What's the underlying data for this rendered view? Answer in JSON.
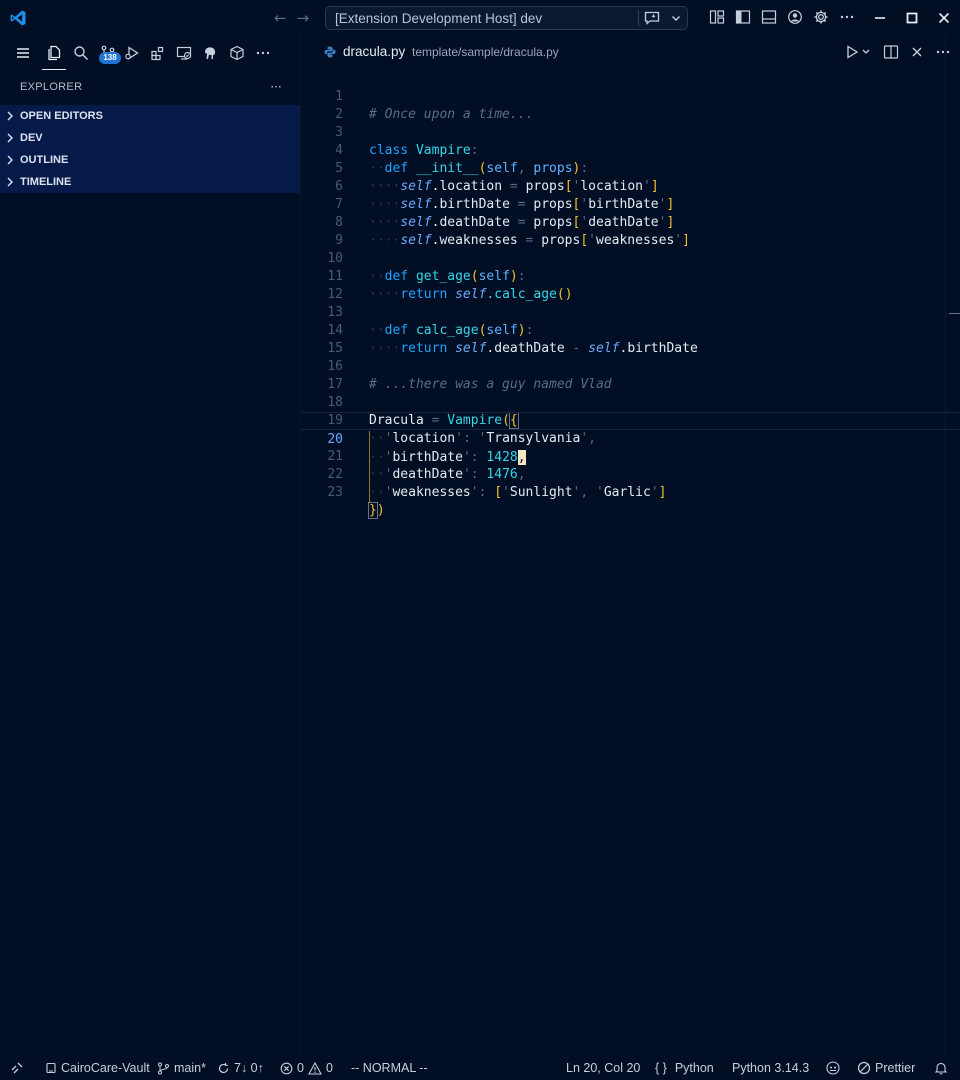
{
  "window": {
    "title": "[Extension Development Host] dev"
  },
  "sidebar": {
    "scm_badge": "138",
    "explorer_title": "EXPLORER",
    "more_label": "···",
    "sections": [
      {
        "label": "OPEN EDITORS"
      },
      {
        "label": "DEV"
      },
      {
        "label": "OUTLINE"
      },
      {
        "label": "TIMELINE"
      }
    ]
  },
  "editor": {
    "tab": {
      "name": "dracula.py",
      "path": "template/sample/dracula.py"
    },
    "language_color": "#3b82c4",
    "current_line": 20,
    "line_numbers": [
      "1",
      "2",
      "3",
      "4",
      "5",
      "6",
      "7",
      "8",
      "9",
      "10",
      "11",
      "12",
      "13",
      "14",
      "15",
      "16",
      "17",
      "18",
      "19",
      "20",
      "21",
      "22",
      "23"
    ],
    "code": {
      "l1": "# Once upon a time...",
      "l3_kw": "class",
      "l3_name": "Vampire",
      "l4_kw": "def",
      "l4_fn": "__init__",
      "l4_p1": "self",
      "l4_p2": "props",
      "l5_self": "self",
      "l5_attr": ".location",
      "l5_props": "props",
      "l5_key": "location",
      "l6_self": "self",
      "l6_attr": ".birthDate",
      "l6_props": "props",
      "l6_key": "birthDate",
      "l7_self": "self",
      "l7_attr": ".deathDate",
      "l7_props": "props",
      "l7_key": "deathDate",
      "l8_self": "self",
      "l8_attr": ".weaknesses",
      "l8_props": "props",
      "l8_key": "weaknesses",
      "l10_kw": "def",
      "l10_fn": "get_age",
      "l10_p": "self",
      "l11_kw": "return",
      "l11_self": "self",
      "l11_call": ".calc_age",
      "l13_kw": "def",
      "l13_fn": "calc_age",
      "l13_p": "self",
      "l14_kw": "return",
      "l14_self1": "self",
      "l14_attr1": ".deathDate",
      "l14_self2": "self",
      "l14_attr2": ".birthDate",
      "l16": "# ...there was a guy named Vlad",
      "l18_var": "Dracula",
      "l18_cls": "Vampire",
      "l19_key": "location",
      "l19_val": "Transylvania",
      "l20_key": "birthDate",
      "l20_val": "1428",
      "l21_key": "deathDate",
      "l21_val": "1476",
      "l22_key": "weaknesses",
      "l22_v1": "Sunlight",
      "l22_v2": "Garlic"
    }
  },
  "statusbar": {
    "workspace": "CairoCare-Vault",
    "branch": "main*",
    "sync": "7↓ 0↑",
    "errors": "0",
    "warnings": "0",
    "mode": "-- NORMAL --",
    "position": "Ln 20, Col 20",
    "language": "Python",
    "interpreter": "Python 3.14.3",
    "formatter": "Prettier"
  }
}
